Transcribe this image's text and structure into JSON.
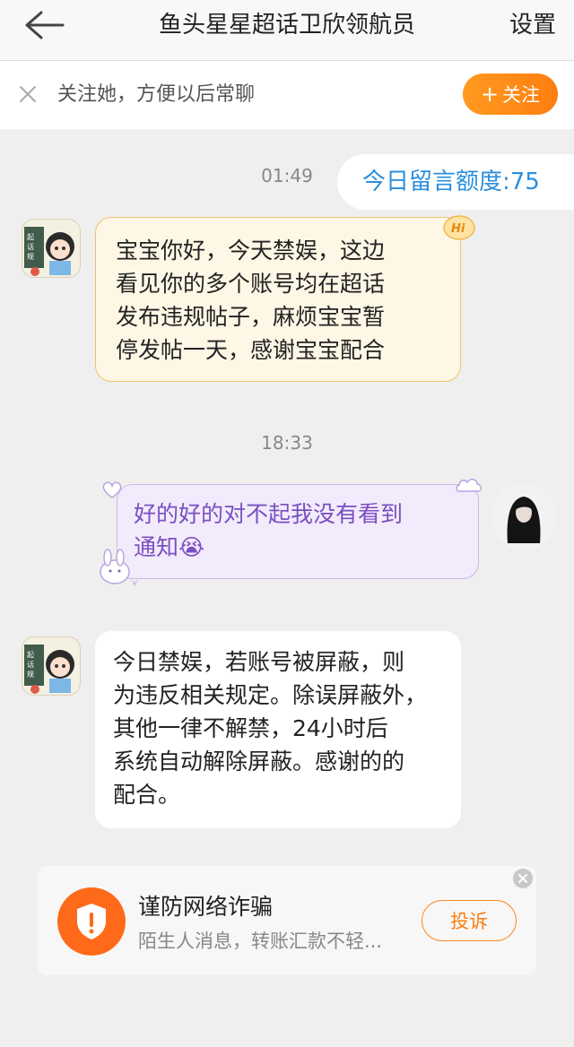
{
  "header": {
    "title": "鱼头星星超话卫欣领航员",
    "settings_label": "设置"
  },
  "follow_bar": {
    "text": "关注她，方便以后常聊",
    "button_label": "关注",
    "button_icon": "plus-icon"
  },
  "quota": {
    "text": "今日留言额度:75"
  },
  "messages": [
    {
      "time": "01:49",
      "sender": "admin",
      "lines": [
        "宝宝你好，今天禁娱，这边",
        "看见你的多个账号均在超话",
        "发布违规帖子，麻烦宝宝暂",
        "停发帖一天，感谢宝宝配合"
      ],
      "badge": "Hi"
    },
    {
      "time": "18:33",
      "sender": "self",
      "lines": [
        "好的好的对不起我没有看到",
        "通知😭"
      ]
    },
    {
      "sender": "admin",
      "lines": [
        "今日禁娱，若账号被屏蔽，则",
        "为违反相关规定。除误屏蔽外，",
        "其他一律不解禁，24小时后",
        "系统自动解除屏蔽。感谢的的",
        "配合。"
      ]
    }
  ],
  "avatar_badge": [
    "起话规则",
    "小卫酱"
  ],
  "fraud_card": {
    "title": "谨防网络诈骗",
    "subtitle": "陌生人消息，转账汇款不轻...",
    "report_label": "投诉"
  },
  "colors": {
    "accent_orange": "#ff7d10",
    "quota_blue": "#2b8fdc",
    "self_bubble_text": "#7a4fc2"
  }
}
